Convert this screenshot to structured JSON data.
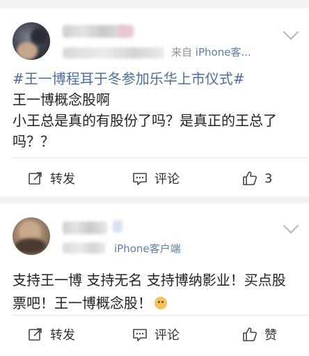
{
  "posts": [
    {
      "source_prefix": "来自",
      "source": "iPhone客...",
      "hashtag": "#王一博程耳于冬参加乐华上市仪式#",
      "body_line1": "王一博概念股啊",
      "body_line2": "小王总是真的有股份了吗？是真正的王总了吗？？",
      "actions": {
        "repost": "转发",
        "comment": "评论",
        "like": "3"
      }
    },
    {
      "source": "iPhone客户端",
      "body": "支持王一博 支持无名 支持博纳影业！买点股票吧！王一博概念股！",
      "actions": {
        "repost": "转发",
        "comment": "评论",
        "like": "赞"
      }
    }
  ],
  "icons": {
    "repost": "repost-icon",
    "comment": "comment-icon",
    "like": "thumbs-up-icon",
    "more": "chevron-down-icon"
  },
  "colors": {
    "hashtag": "#4a6fa8",
    "source_link": "#5b7db0",
    "background": "#f2f2f2"
  }
}
